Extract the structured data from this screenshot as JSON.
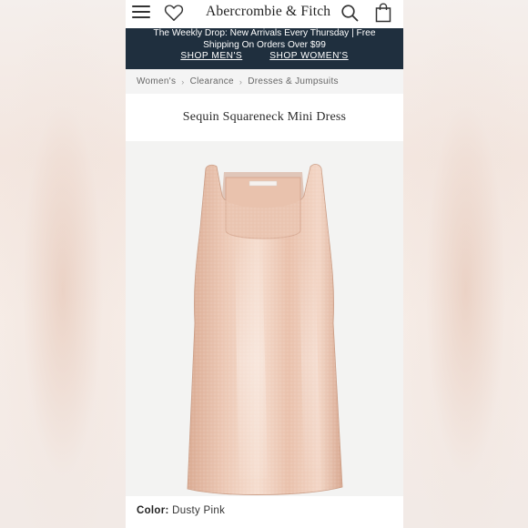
{
  "header": {
    "brand": "Abercrombie & Fitch",
    "icons": [
      "menu-icon",
      "heart-icon",
      "search-icon",
      "bag-icon"
    ]
  },
  "promo": {
    "text": "The Weekly Drop: New Arrivals Every Thursday | Free Shipping On Orders Over $99",
    "link_men": "SHOP MEN'S",
    "link_women": "SHOP WOMEN'S"
  },
  "breadcrumb": {
    "items": [
      "Women's",
      "Clearance",
      "Dresses & Jumpsuits"
    ],
    "separator": "›"
  },
  "product": {
    "title": "Sequin Squareneck Mini Dress",
    "color_label": "Color:",
    "color_value": "Dusty Pink"
  },
  "colors": {
    "promo_bg": "#1f2f3e",
    "dress": "#e6bfa9"
  }
}
